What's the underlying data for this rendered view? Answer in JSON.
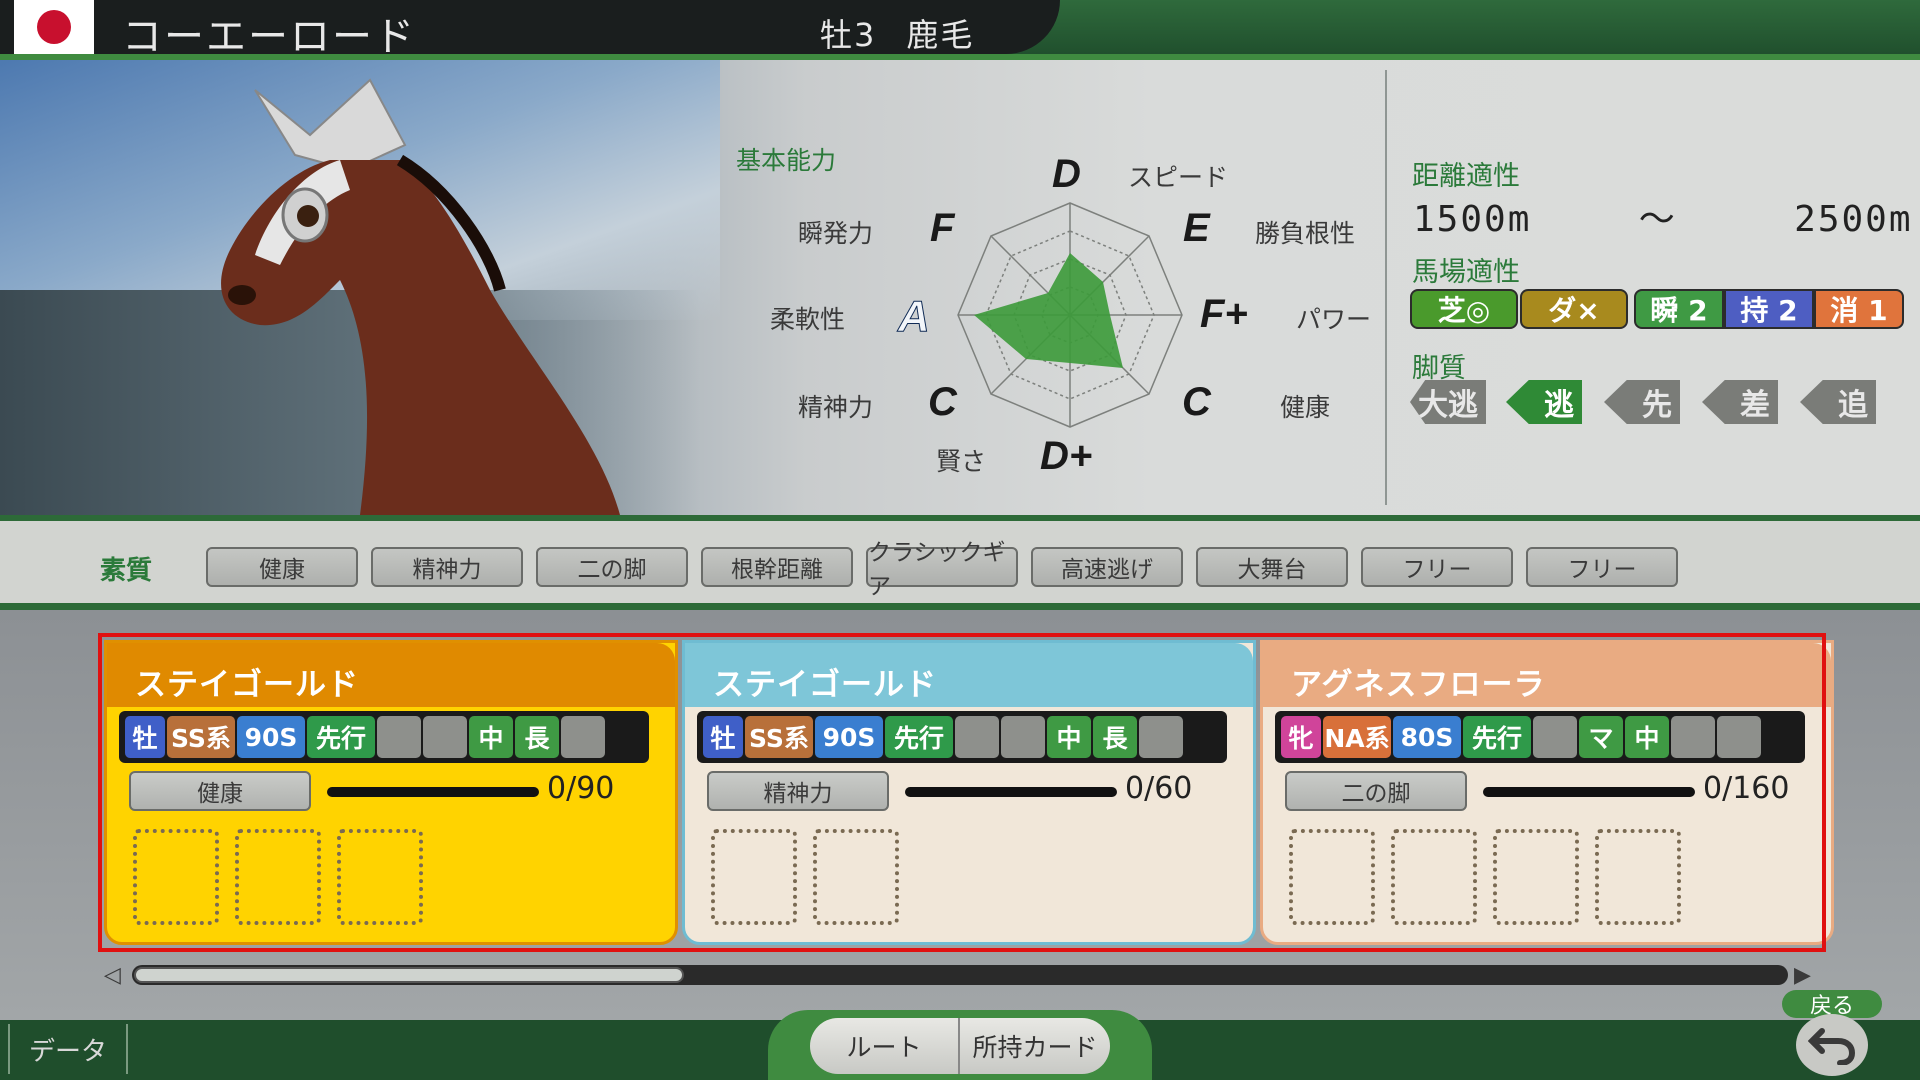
{
  "header": {
    "horse_name": "コーエーロード",
    "sex_age": "牡3",
    "coat": "鹿毛"
  },
  "abilities": {
    "section_label": "基本能力",
    "items": [
      {
        "name": "スピード",
        "grade": "D"
      },
      {
        "name": "勝負根性",
        "grade": "E"
      },
      {
        "name": "パワー",
        "grade": "F+"
      },
      {
        "name": "健康",
        "grade": "C"
      },
      {
        "name": "賢さ",
        "grade": "D+"
      },
      {
        "name": "精神力",
        "grade": "C"
      },
      {
        "name": "柔軟性",
        "grade": "A"
      },
      {
        "name": "瞬発力",
        "grade": "F"
      }
    ]
  },
  "aptitude": {
    "distance_label": "距離適性",
    "distance_min": "1500m",
    "distance_sep": "～",
    "distance_max": "2500m",
    "track_label": "馬場適性",
    "turf": "芝◎",
    "dirt": "ダ×",
    "params": [
      "瞬 2",
      "持 2",
      "消 1"
    ],
    "style_label": "脚質",
    "styles": [
      "大逃",
      "逃",
      "先",
      "差",
      "追"
    ],
    "active_style_index": 1
  },
  "traits": {
    "label": "素質",
    "items": [
      "健康",
      "精神力",
      "二の脚",
      "根幹距離",
      "クラシックギア",
      "高速逃げ",
      "大舞台",
      "フリー",
      "フリー"
    ]
  },
  "cards": [
    {
      "title": "ステイゴールド",
      "tags": [
        "牡",
        "SS系",
        "90S",
        "先行",
        "",
        "",
        "中",
        "長",
        ""
      ],
      "skill": "健康",
      "gauge": "0/90",
      "slots": 3
    },
    {
      "title": "ステイゴールド",
      "tags": [
        "牡",
        "SS系",
        "90S",
        "先行",
        "",
        "",
        "中",
        "長",
        ""
      ],
      "skill": "精神力",
      "gauge": "0/60",
      "slots": 2
    },
    {
      "title": "アグネスフローラ",
      "tags": [
        "牝",
        "NA系",
        "80S",
        "先行",
        "",
        "マ",
        "中",
        "",
        ""
      ],
      "skill": "二の脚",
      "gauge": "0/160",
      "slots": 4
    }
  ],
  "footer": {
    "data_label": "データ",
    "route_label": "ルート",
    "cards_label": "所持カード",
    "back_label": "戻る"
  },
  "colors": {
    "header_green": "#3f8b40",
    "card1": "#ffd300",
    "card2_title": "#7ec6d8",
    "card3_title": "#e9ab82",
    "highlight_frame": "#e01010",
    "radar_fill": "#3c9a3a"
  }
}
